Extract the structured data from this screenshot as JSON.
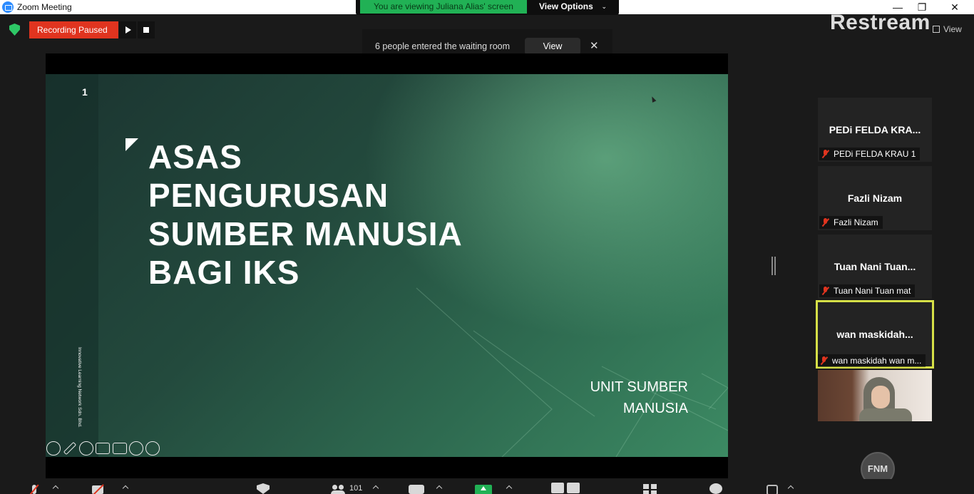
{
  "window": {
    "title": "Zoom Meeting",
    "minimize": "—",
    "restore": "❐",
    "close": "✕"
  },
  "share_banner": {
    "text": "You are viewing Juliana Alias' screen",
    "view_options": "View Options"
  },
  "recording": {
    "status": "Recording Paused"
  },
  "waiting_room": {
    "message": "6 people entered the waiting room",
    "view_label": "View",
    "close_label": "✕"
  },
  "watermark": {
    "brand": "Restream",
    "view_label": "View"
  },
  "slide": {
    "number": "1",
    "title_lines": [
      "ASAS",
      "PENGURUSAN",
      "SUMBER MANUSIA",
      "BAGI IKS"
    ],
    "unit_lines": [
      "UNIT SUMBER",
      "MANUSIA"
    ],
    "vertical_credit": "Innovative Learning Network Sdn. Bhd."
  },
  "participants": [
    {
      "display": "PEDi FELDA KRA...",
      "label": "PEDi FELDA KRAU 1",
      "muted": true,
      "active": false
    },
    {
      "display": "Fazli Nizam",
      "label": "Fazli Nizam",
      "muted": true,
      "active": false
    },
    {
      "display": "Tuan  Nani  Tuan...",
      "label": "Tuan Nani Tuan mat",
      "muted": true,
      "active": false
    },
    {
      "display": "wan  maskidah...",
      "label": "wan maskidah wan m...",
      "muted": true,
      "active": true
    }
  ],
  "self": {
    "initials": "FNM"
  },
  "toolbar": {
    "participants_count": "101"
  },
  "colors": {
    "recording_red": "#e0341f",
    "share_green": "#21b155",
    "active_speaker": "#d6e047",
    "zoom_blue": "#2d8cff"
  }
}
